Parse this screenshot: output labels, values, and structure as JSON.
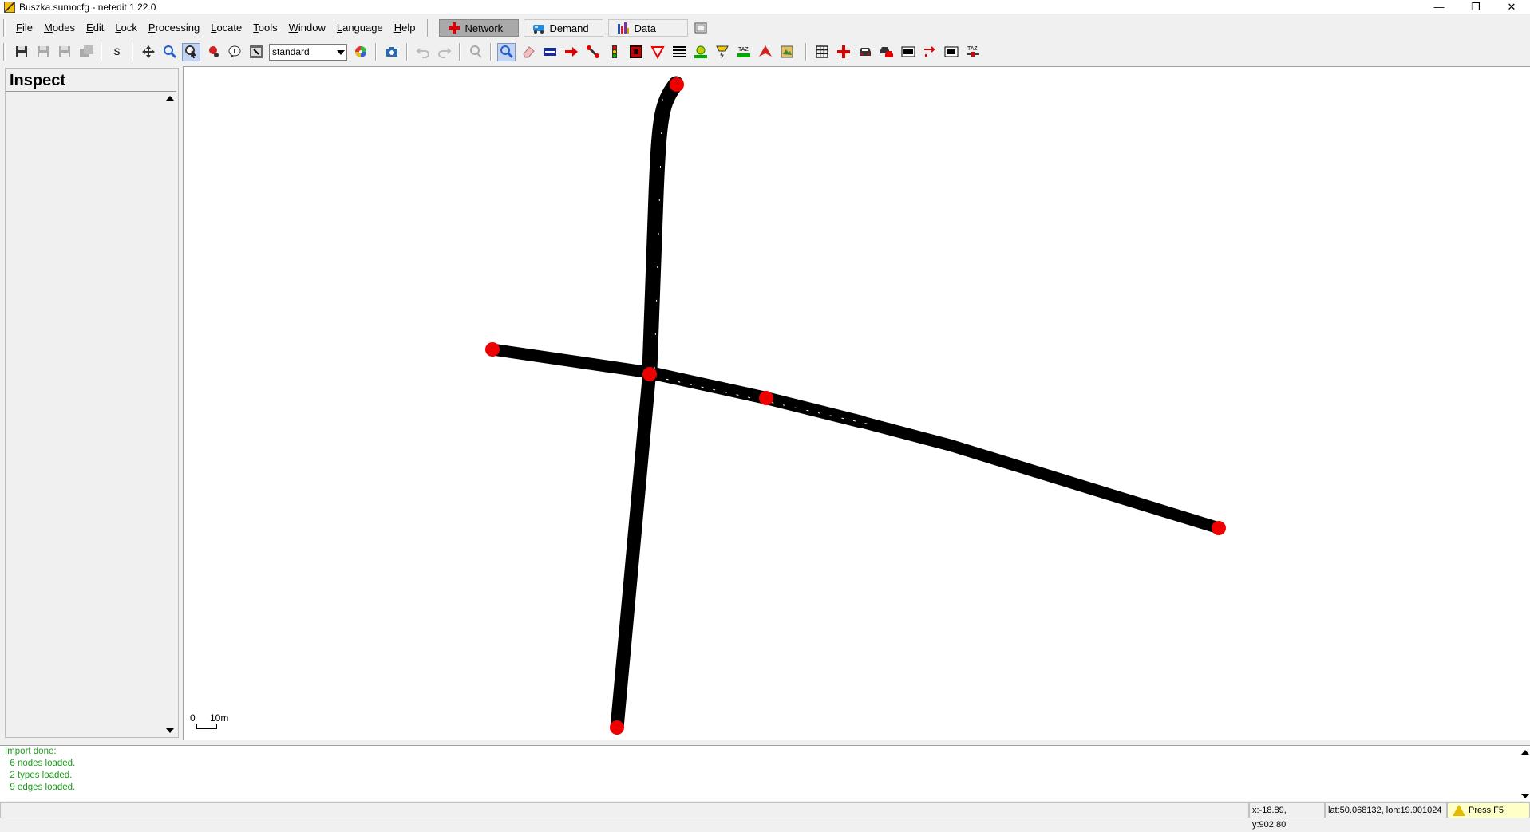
{
  "window": {
    "title": "Buszka.sumocfg - netedit 1.22.0",
    "minimize": "—",
    "restore": "❐",
    "close": "✕"
  },
  "menu": [
    "File",
    "Modes",
    "Edit",
    "Lock",
    "Processing",
    "Locate",
    "Tools",
    "Window",
    "Language",
    "Help"
  ],
  "supermodes": [
    {
      "label": "Network",
      "active": true,
      "icon": "network-icon"
    },
    {
      "label": "Demand",
      "active": false,
      "icon": "demand-icon"
    },
    {
      "label": "Data",
      "active": false,
      "icon": "data-icon"
    }
  ],
  "toolbar": {
    "s_label": "S",
    "scheme": "standard"
  },
  "inspect": {
    "title": "Inspect"
  },
  "canvas": {
    "scale_zero": "0",
    "scale_length": "10m",
    "junction_color": "#ee0000",
    "edge_color": "#000000"
  },
  "messages": [
    "Import done:",
    "  6 nodes loaded.",
    "  2 types loaded.",
    "  9 edges loaded."
  ],
  "status": {
    "xy": "x:-18.89, y:902.80",
    "latlon": "lat:50.068132, lon:19.901024",
    "press": "Press F5"
  }
}
